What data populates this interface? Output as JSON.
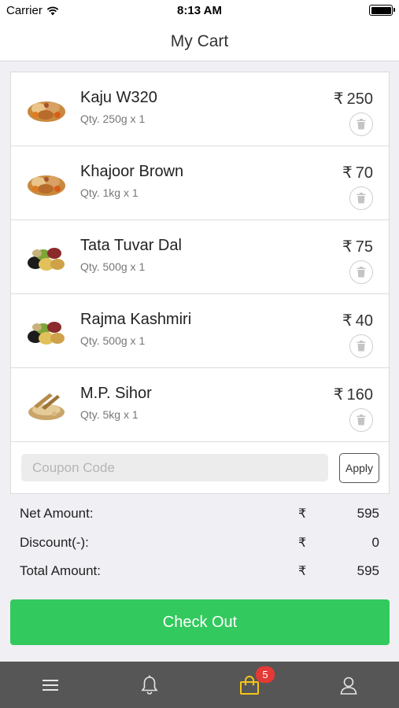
{
  "status_bar": {
    "carrier": "Carrier",
    "time": "8:13 AM"
  },
  "header": {
    "title": "My Cart"
  },
  "cart": {
    "items": [
      {
        "name": "Kaju W320",
        "qty": "Qty. 250g x 1",
        "currency": "₹",
        "price": "250",
        "image": "dry-fruits-thumb"
      },
      {
        "name": "Khajoor Brown",
        "qty": "Qty. 1kg x 1",
        "currency": "₹",
        "price": "70",
        "image": "dry-fruits-thumb"
      },
      {
        "name": "Tata Tuvar Dal",
        "qty": "Qty. 500g x 1",
        "currency": "₹",
        "price": "75",
        "image": "pulses-thumb"
      },
      {
        "name": "Rajma Kashmiri",
        "qty": "Qty. 500g x 1",
        "currency": "₹",
        "price": "40",
        "image": "pulses-thumb"
      },
      {
        "name": "M.P. Sihor",
        "qty": "Qty. 5kg x 1",
        "currency": "₹",
        "price": "160",
        "image": "wheat-thumb"
      }
    ]
  },
  "coupon": {
    "placeholder": "Coupon Code",
    "value": "",
    "apply_label": "Apply"
  },
  "totals": {
    "rows": [
      {
        "label": "Net Amount:",
        "currency": "₹",
        "amount": "595"
      },
      {
        "label": "Discount(-):",
        "currency": "₹",
        "amount": "0"
      },
      {
        "label": "Total Amount:",
        "currency": "₹",
        "amount": "595"
      }
    ]
  },
  "checkout": {
    "label": "Check Out"
  },
  "tab_bar": {
    "tabs": [
      {
        "icon": "menu-icon"
      },
      {
        "icon": "bell-icon"
      },
      {
        "icon": "cart-bag-icon",
        "badge": "5",
        "active": true
      },
      {
        "icon": "profile-icon"
      }
    ]
  },
  "colors": {
    "accent": "#32c95e",
    "tab_bar": "#565656",
    "active_tab": "#f5c518",
    "badge": "#e53935"
  }
}
